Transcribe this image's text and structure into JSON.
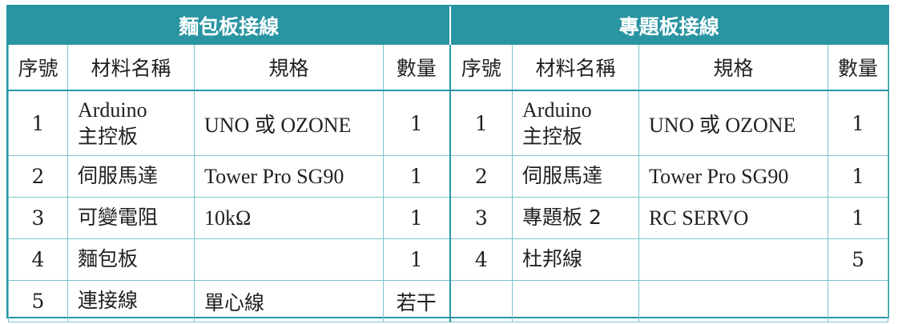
{
  "left": {
    "title": "麵包板接線",
    "headers": [
      "序號",
      "材料名稱",
      "規格",
      "數量"
    ],
    "rows": [
      {
        "num": "1",
        "name_en": "Arduino",
        "name_zh": "主控板",
        "spec": "UNO 或 OZONE",
        "qty": "1"
      },
      {
        "num": "2",
        "name": "伺服馬達",
        "spec": "Tower Pro SG90",
        "qty": "1"
      },
      {
        "num": "3",
        "name": "可變電阻",
        "spec": "10kΩ",
        "qty": "1"
      },
      {
        "num": "4",
        "name": "麵包板",
        "spec": "",
        "qty": "1"
      },
      {
        "num": "5",
        "name": "連接線",
        "spec": "單心線",
        "qty": "若干"
      }
    ]
  },
  "right": {
    "title": "專題板接線",
    "headers": [
      "序號",
      "材料名稱",
      "規格",
      "數量"
    ],
    "rows": [
      {
        "num": "1",
        "name_en": "Arduino",
        "name_zh": "主控板",
        "spec": "UNO 或 OZONE",
        "qty": "1"
      },
      {
        "num": "2",
        "name": "伺服馬達",
        "spec": "Tower Pro SG90",
        "qty": "1"
      },
      {
        "num": "3",
        "name": "專題板 2",
        "spec": "RC SERVO",
        "qty": "1"
      },
      {
        "num": "4",
        "name": "杜邦線",
        "spec": "",
        "qty": "5"
      },
      {
        "num": "",
        "name": "",
        "spec": "",
        "qty": ""
      }
    ]
  },
  "colors": {
    "header_bg": "#2a95a2",
    "header_text": "#ffffff",
    "grid_line": "#7cc3cc",
    "text": "#231f20"
  }
}
